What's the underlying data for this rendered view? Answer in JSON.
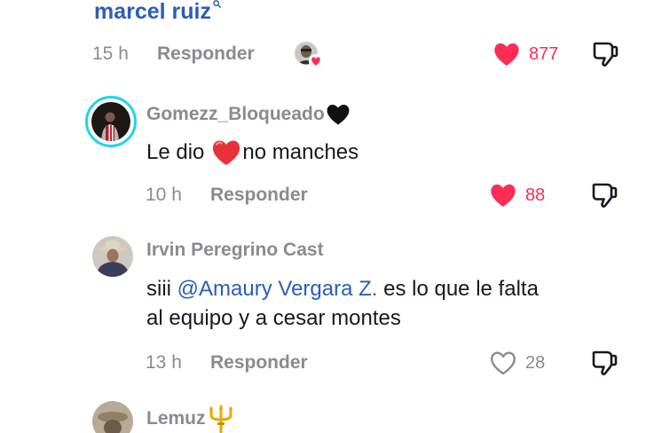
{
  "top": {
    "mention": "marcel ruiz",
    "time": "15 h",
    "reply_label": "Responder",
    "likes": "877",
    "liked": true
  },
  "comments": [
    {
      "username": "Gomezz_Bloqueado",
      "badge_icon": "black-heart-emoji",
      "text_parts": [
        "Le dio",
        "no manches"
      ],
      "inline_emoji": "red-heart-emoji",
      "time": "10 h",
      "reply_label": "Responder",
      "likes": "88",
      "liked": true
    },
    {
      "username": "Irvin Peregrino Cast",
      "text_prefix": "siii",
      "mention": "@Amaury Vergara Z.",
      "text_rest_line1": "es lo que le falta",
      "text_line2": "al equipo y a cesar montes",
      "time": "13 h",
      "reply_label": "Responder",
      "likes": "28",
      "liked": false
    },
    {
      "username": "Lemuz",
      "badge_icon": "trident-emoji"
    }
  ],
  "colors": {
    "like_active": "#fe2c55",
    "mention": "#2b5db9",
    "muted": "#8a8b91",
    "avatar_ring": "#20d5ec"
  }
}
